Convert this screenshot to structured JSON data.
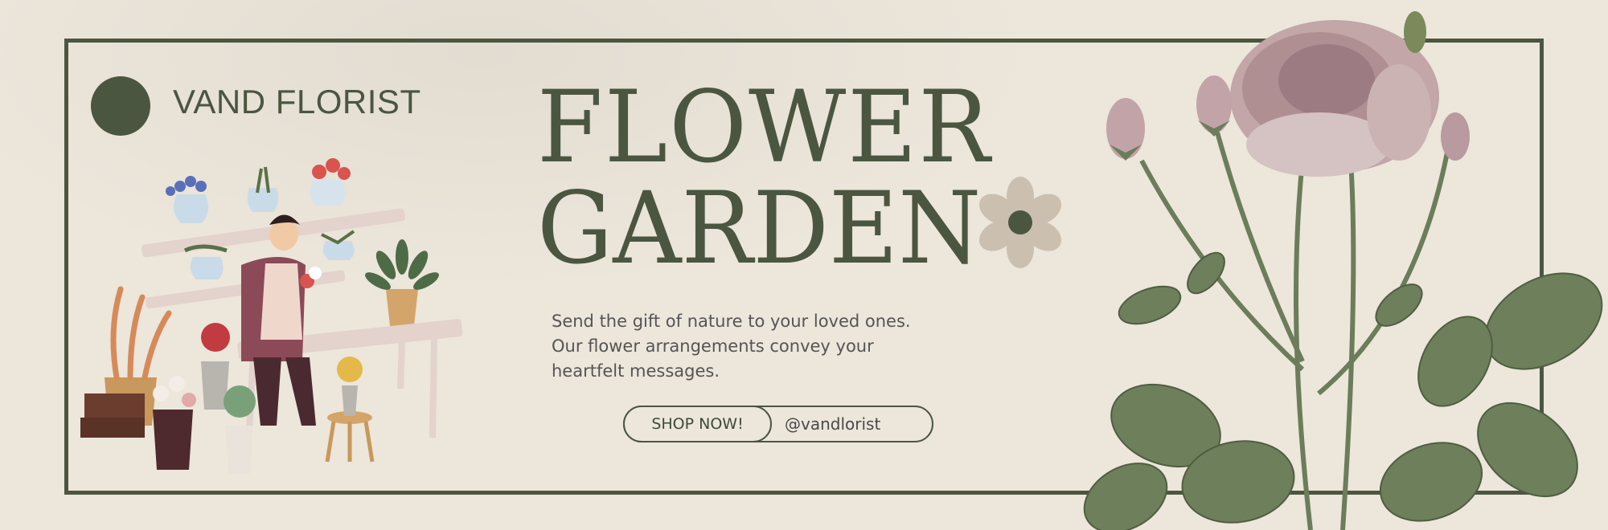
{
  "brand": {
    "name": "VAND FLORIST"
  },
  "headline": {
    "line1": "FLOWER",
    "line2": "GARDEN"
  },
  "tagline": [
    "Send the gift of nature to your loved ones.",
    "Our flower arrangements convey your",
    "heartfelt messages."
  ],
  "cta": {
    "button_label": "SHOP NOW!",
    "handle": "@vandlorist"
  },
  "colors": {
    "background": "#ece6db",
    "primary": "#4b5640",
    "flower_petal": "#cbbfb0",
    "rose_pink": "#b79aa0",
    "leaf": "#6b7d5a"
  },
  "icons": [
    "logo-dot-icon",
    "flower-icon",
    "florist-illustration",
    "rose-illustration"
  ]
}
